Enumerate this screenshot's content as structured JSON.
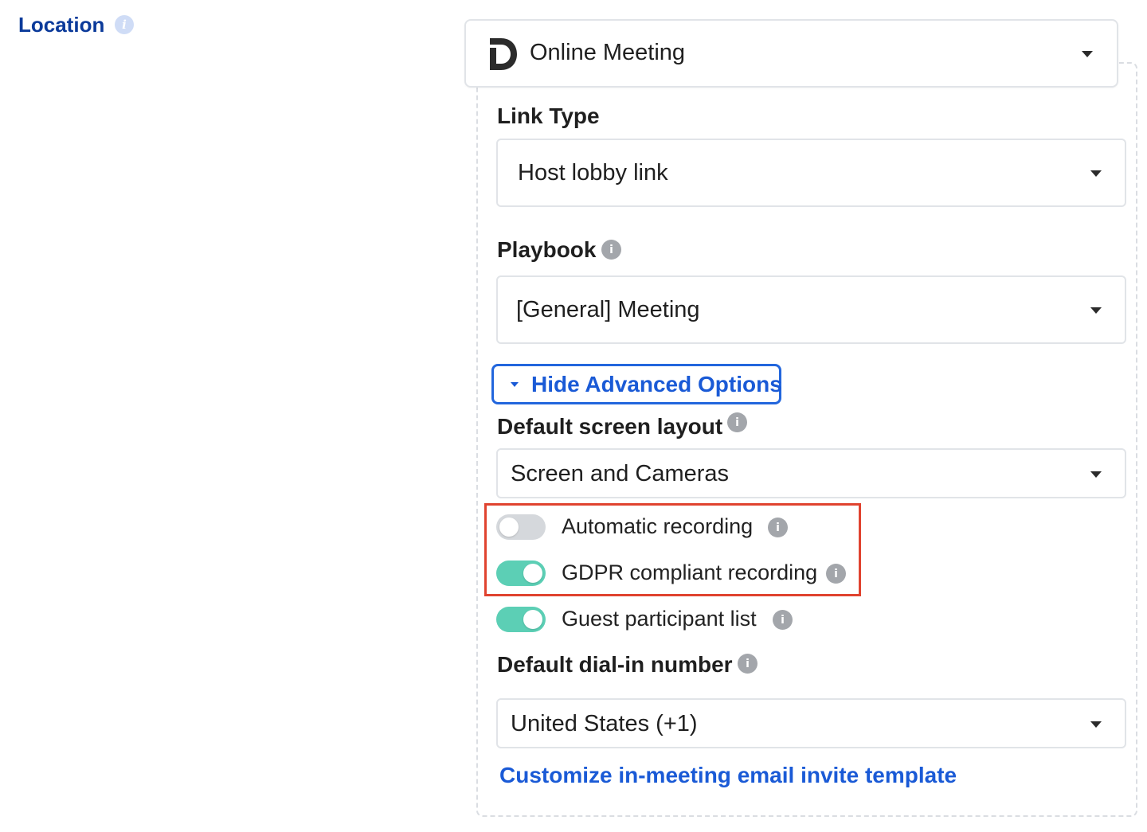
{
  "location": {
    "label": "Location",
    "info_icon": "info-icon",
    "selected": "Online Meeting",
    "provider_logo": "dialpad-logo"
  },
  "link_type": {
    "label": "Link Type",
    "value": "Host lobby link"
  },
  "playbook": {
    "label": "Playbook",
    "value": "[General] Meeting"
  },
  "advanced_toggle": {
    "label": "Hide Advanced Options"
  },
  "screen_layout": {
    "label": "Default screen layout",
    "value": "Screen and Cameras"
  },
  "toggles": [
    {
      "label": "Automatic recording",
      "on": false
    },
    {
      "label": "GDPR compliant recording",
      "on": true
    },
    {
      "label": "Guest participant list",
      "on": true
    }
  ],
  "dial_in": {
    "label": "Default dial-in number",
    "value": "United States (+1)"
  },
  "customize_link": "Customize in-meeting email invite template",
  "colors": {
    "accent": "#1a5ad6",
    "toggle_on": "#5ccfb5",
    "toggle_off": "#d5d8dc",
    "highlight": "#e0432f",
    "location_label": "#0b3a9a"
  }
}
